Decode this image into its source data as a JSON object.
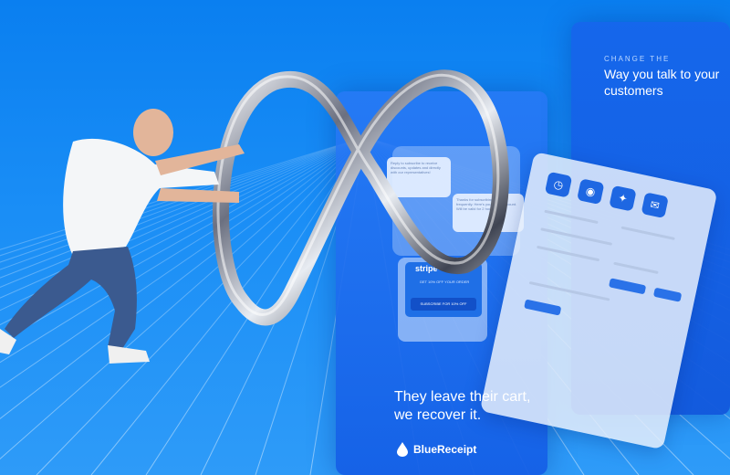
{
  "right_card": {
    "eyebrow": "CHANGE THE",
    "headline": "Way you talk to your customers"
  },
  "center_card": {
    "tagline": "They leave their cart, we recover it.",
    "brand": "BlueReceipt"
  },
  "phone": {
    "stripe_label": "stripe",
    "offer": "GET 10% OFF YOUR ORDER",
    "button": "SUBSCRIBE FOR 10% OFF",
    "bubble_1": "Reply to subscribe to receive discounts, updates and directly with our representatives!",
    "bubble_2": "Thanks for subscribing! Kate frequently. Here's your 10% discount. Will be valid for 2 hours."
  },
  "panel_icons": [
    "clock-icon",
    "camera-icon",
    "compass-icon",
    "mail-icon"
  ],
  "colors": {
    "background_top": "#0a7ff0",
    "card_blue": "#1e67e2",
    "white": "#ffffff"
  }
}
